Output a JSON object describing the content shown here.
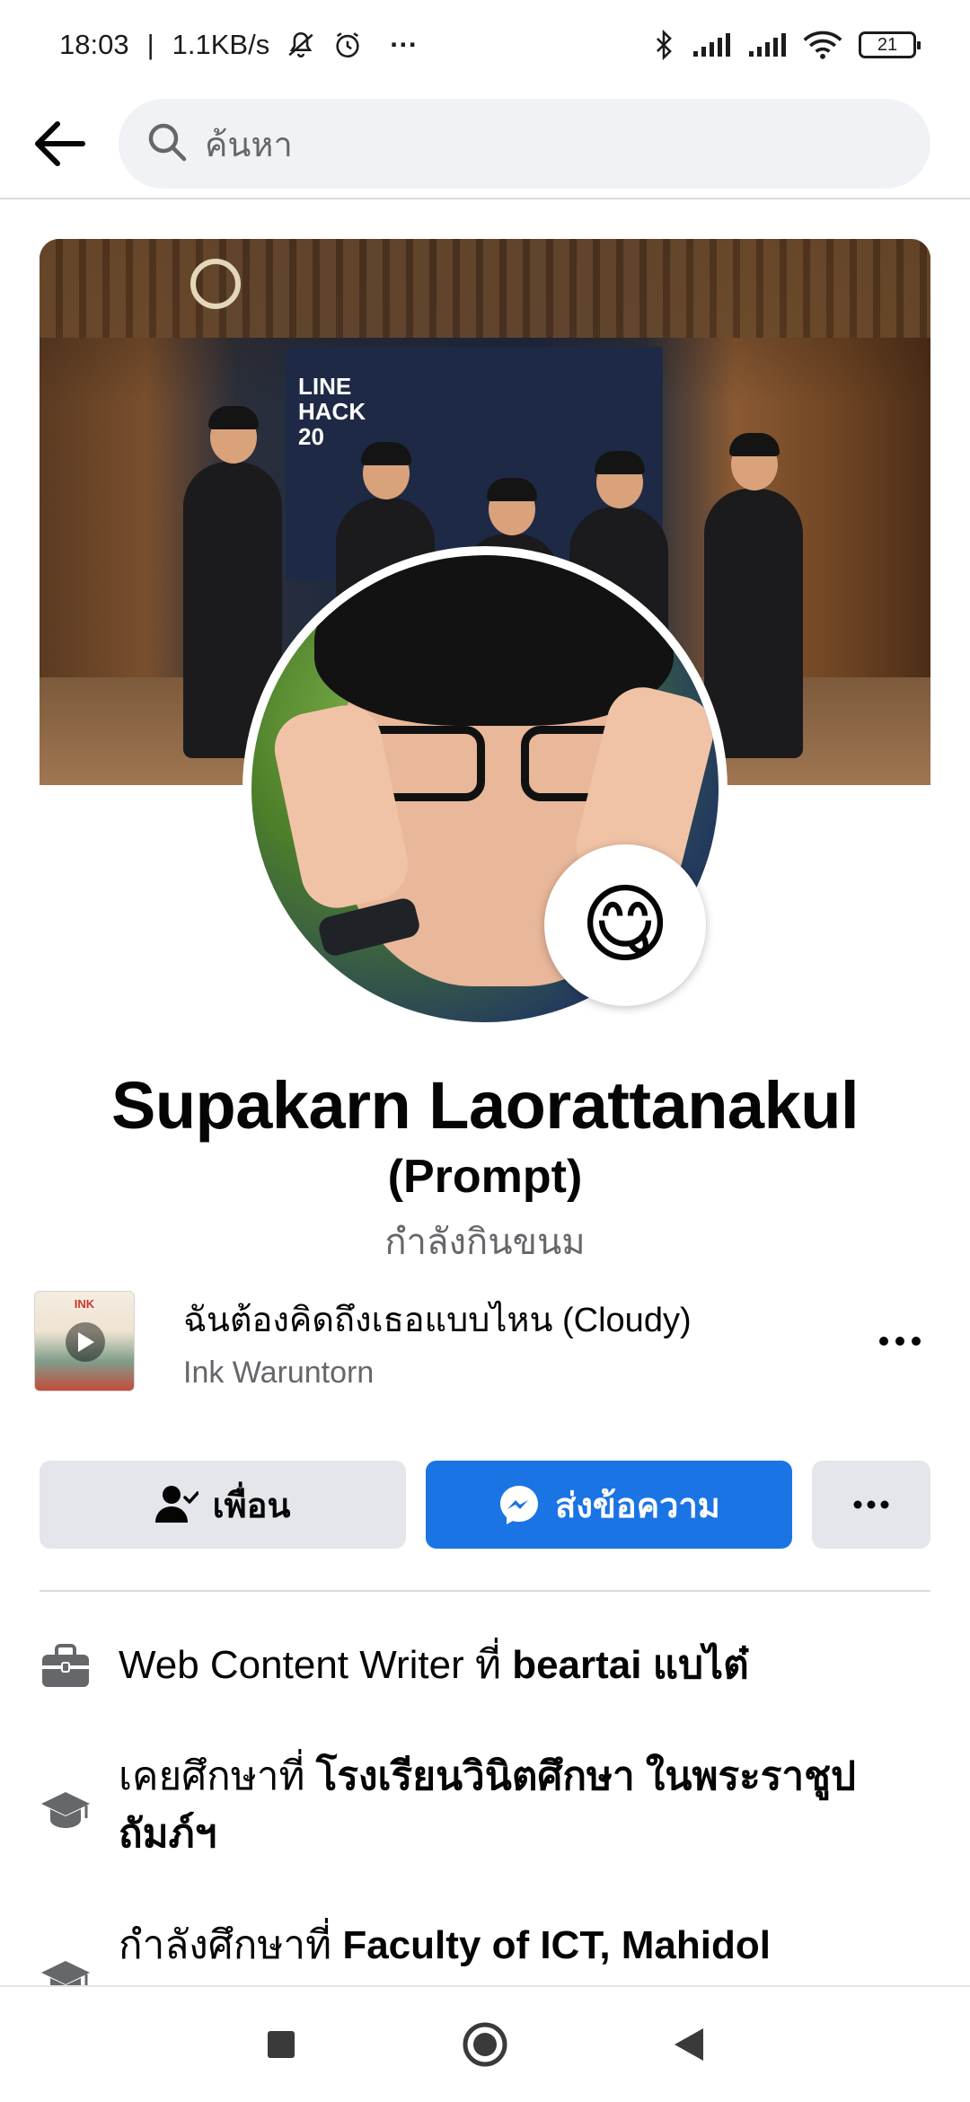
{
  "status_bar": {
    "time": "18:03",
    "separator": "|",
    "network_speed": "1.1KB/s",
    "more": "···",
    "battery": "21",
    "icons": [
      "mute-bell-icon",
      "alarm-icon",
      "bluetooth-icon",
      "signal-icon",
      "signal-icon",
      "wifi-icon",
      "battery-icon"
    ]
  },
  "search": {
    "placeholder": "ค้นหา"
  },
  "cover": {
    "backdrop_text_line1": "LINE",
    "backdrop_text_line2": "HACK",
    "backdrop_text_line3": "20"
  },
  "profile": {
    "name": "Supakarn Laorattanakul",
    "nickname": "(Prompt)",
    "status": "กำลังกินขนม",
    "status_emoji": "😋"
  },
  "music": {
    "title": "ฉันต้องคิดถึงเธอแบบไหน (Cloudy)",
    "artist": "Ink Waruntorn",
    "album_art_text": "INK"
  },
  "actions": {
    "friends_label": "เพื่อน",
    "message_label": "ส่งข้อความ"
  },
  "info": {
    "work_prefix": "Web Content Writer ที่ ",
    "work_place": "beartai แบไต๋",
    "studied_prefix": "เคยศึกษาที่ ",
    "studied_place": "โรงเรียนวินิตศึกษา ในพระราชูปถัมภ์ฯ",
    "studying_prefix": "กำลังศึกษาที่ ",
    "studying_place": "Faculty of ICT, Mahidol"
  },
  "colors": {
    "accent": "#1b74e4",
    "secondary_text": "#65676b",
    "button_gray": "#e4e6eb"
  }
}
